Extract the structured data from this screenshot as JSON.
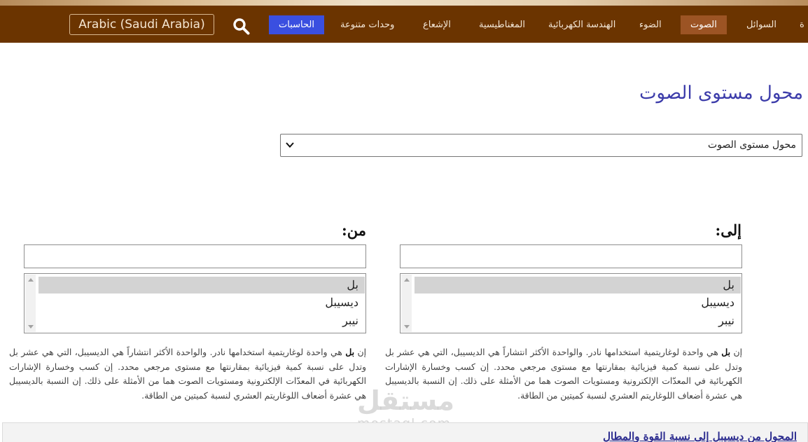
{
  "nav": {
    "items": [
      {
        "label": "ة",
        "state": "normal"
      },
      {
        "label": "السوائل",
        "state": "normal"
      },
      {
        "label": "الصوت",
        "state": "active"
      },
      {
        "label": "الضوء",
        "state": "normal"
      },
      {
        "label": "الهندسة الكهربائية",
        "state": "normal"
      },
      {
        "label": "المغناطيسية",
        "state": "normal"
      },
      {
        "label": "الإشعاع",
        "state": "normal"
      },
      {
        "label": "وحدات متنوعة",
        "state": "normal"
      },
      {
        "label": "الحاسبات",
        "state": "highlight"
      }
    ],
    "language_button": "Arabic (Saudi Arabia)",
    "search_icon": "search-icon"
  },
  "page": {
    "title": "محول مستوى الصوت",
    "converter_select_value": "محول مستوى الصوت"
  },
  "to_panel": {
    "label": "إلى:",
    "input_value": "",
    "units": [
      "بل",
      "ديسيبل",
      "نيبر"
    ],
    "selected_index": 0
  },
  "from_panel": {
    "label": "من:",
    "input_value": "",
    "units": [
      "بل",
      "ديسيبل",
      "نيبر"
    ],
    "selected_index": 0
  },
  "description": {
    "prefix": "إن ",
    "bold_term": "بل",
    "body": " هي واحدة لوغاريتمية استخدامها نادر. والواحدة الأكثر انتشاراً هي الديسيبل، التي هي عشر بل وتدل على نسبة كمية فيزيائية بمقارنتها مع مستوى مرجعي محدد. إن كسب وخسارة الإشارات الكهربائية في المعدّات الإلكترونية ومستويات الصوت هما من الأمثلة على ذلك. إن النسبة بالديسيبل هي عشرة أضعاف اللوغاريتم العشري لنسبة كميتين من الطاقة."
  },
  "watermark": {
    "logo_text": "مستقل",
    "url_text": "mostaql.com"
  },
  "bottom": {
    "link_text": "المحول من ديسيبل إلى نسبة القوة والمطال"
  },
  "colors": {
    "navbar": "#6b3400",
    "nav_active": "#9c5424",
    "nav_calc": "#3a4fe0",
    "title": "#3c3caa"
  }
}
